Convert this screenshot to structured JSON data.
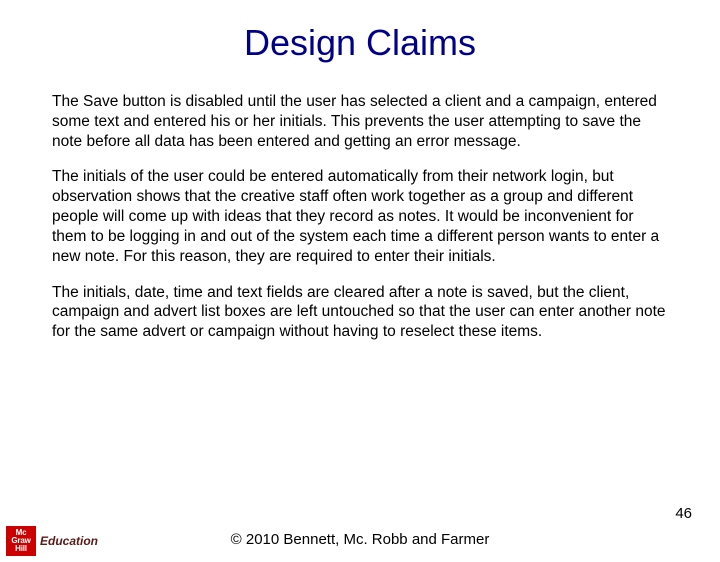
{
  "title": "Design Claims",
  "paragraphs": [
    "The Save button is disabled until the user has selected a client and a campaign, entered some text and entered his or her initials.  This prevents the user attempting to save the note before all data has been entered and getting an error message.",
    "The initials of the user could be entered automatically from their network login, but observation shows that the creative staff often work together as a group and different people will come up with ideas that they record as notes.   It would be inconvenient for them to be logging in and out of the system each time a different person wants to enter a new note.  For this reason, they are required to enter their initials.",
    "The initials, date, time and text fields are cleared after a note is saved, but the client, campaign and advert list boxes are left untouched so that the user can enter another note for the same advert or campaign without having to reselect these items."
  ],
  "page_number": "46",
  "copyright": "© 2010 Bennett, Mc. Robb and Farmer",
  "logo": {
    "mark_lines": [
      "Mc",
      "Graw",
      "Hill"
    ],
    "text": "Education"
  }
}
